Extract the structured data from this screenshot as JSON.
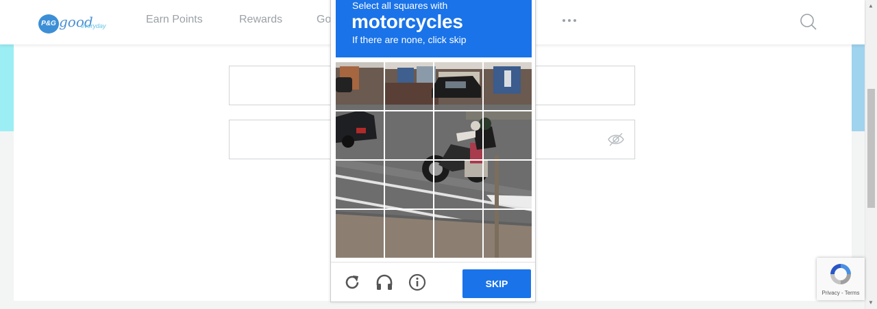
{
  "header": {
    "logo": {
      "badge": "P&G",
      "wordmark": "good",
      "tagline": "everyday"
    },
    "nav": [
      {
        "label": "Earn Points"
      },
      {
        "label": "Rewards"
      },
      {
        "label": "Go"
      }
    ],
    "more_icon": "ellipsis-icon",
    "search_icon": "search-icon"
  },
  "form": {
    "email_field": {
      "value": "",
      "placeholder": ""
    },
    "password_field": {
      "value": "",
      "placeholder": "",
      "toggle_icon": "eye-slash-icon"
    }
  },
  "captcha": {
    "instruction": "Select all squares with",
    "target": "motorcycles",
    "subtext": "If there are none, click skip",
    "grid": {
      "rows": 4,
      "cols": 4
    },
    "footer": {
      "reload_icon": "reload-icon",
      "audio_icon": "headphones-icon",
      "info_icon": "info-icon",
      "skip_label": "SKIP"
    },
    "colors": {
      "accent": "#1a73e8"
    }
  },
  "recaptcha_badge": {
    "links": "Privacy - Terms"
  }
}
